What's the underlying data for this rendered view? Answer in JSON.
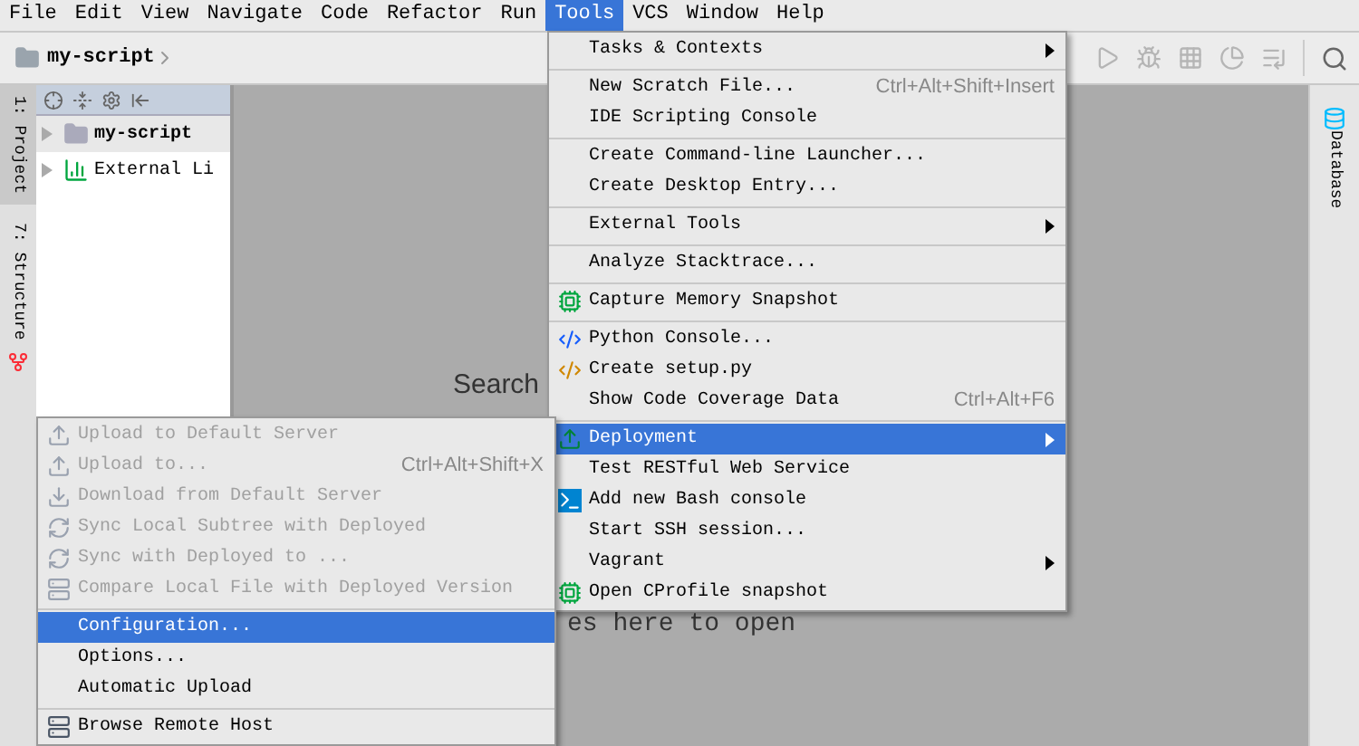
{
  "menubar": [
    {
      "label": "File",
      "selected": false
    },
    {
      "label": "Edit",
      "selected": false
    },
    {
      "label": "View",
      "selected": false
    },
    {
      "label": "Navigate",
      "selected": false
    },
    {
      "label": "Code",
      "selected": false
    },
    {
      "label": "Refactor",
      "selected": false
    },
    {
      "label": "Run",
      "selected": false
    },
    {
      "label": "Tools",
      "selected": true
    },
    {
      "label": "VCS",
      "selected": false
    },
    {
      "label": "Window",
      "selected": false
    },
    {
      "label": "Help",
      "selected": false
    }
  ],
  "navbar": {
    "breadcrumb": "my-script"
  },
  "left_strip": {
    "tabs": [
      "1: Project",
      "7: Structure"
    ]
  },
  "right_strip": {
    "tabs": [
      "Database"
    ]
  },
  "project_tree": [
    {
      "label": "my-script",
      "bold": true
    },
    {
      "label": "External Li",
      "bold": false
    }
  ],
  "editor": {
    "hint_1": "Search",
    "hint_2": "es here to open"
  },
  "tools_menu": {
    "groups": [
      [
        {
          "label": "Tasks & Contexts",
          "submenu": true,
          "selected": false
        }
      ],
      [
        {
          "label": "New Scratch File...",
          "shortcut": "Ctrl+Alt+Shift+Insert",
          "submenu": false,
          "selected": false
        },
        {
          "label": "IDE Scripting Console",
          "submenu": false,
          "selected": false
        }
      ],
      [
        {
          "label": "Create Command-line Launcher...",
          "submenu": false,
          "selected": false
        },
        {
          "label": "Create Desktop Entry...",
          "submenu": false,
          "selected": false
        }
      ],
      [
        {
          "label": "External Tools",
          "submenu": true,
          "selected": false
        }
      ],
      [
        {
          "label": "Analyze Stacktrace...",
          "submenu": false,
          "selected": false
        }
      ],
      [
        {
          "label": "Capture Memory Snapshot",
          "submenu": false,
          "selected": false
        }
      ],
      [
        {
          "label": "Python Console...",
          "submenu": false,
          "selected": false
        },
        {
          "label": "Create setup.py",
          "submenu": false,
          "selected": false
        },
        {
          "label": "Show Code Coverage Data",
          "shortcut": "Ctrl+Alt+F6",
          "submenu": false,
          "selected": false
        }
      ],
      [
        {
          "label": "Deployment",
          "submenu": true,
          "selected": true
        },
        {
          "label": "Test RESTful Web Service",
          "submenu": false,
          "selected": false
        },
        {
          "label": "Add new Bash console",
          "submenu": false,
          "selected": false
        },
        {
          "label": "Start SSH session...",
          "submenu": false,
          "selected": false
        },
        {
          "label": "Vagrant",
          "submenu": true,
          "selected": false
        },
        {
          "label": "Open CProfile snapshot",
          "submenu": false,
          "selected": false
        }
      ]
    ]
  },
  "deployment_menu": {
    "groups": [
      [
        {
          "label": "Upload to Default Server",
          "disabled": true,
          "selected": false
        },
        {
          "label": "Upload to...",
          "shortcut": "Ctrl+Alt+Shift+X",
          "disabled": true,
          "selected": false
        },
        {
          "label": "Download from Default Server",
          "disabled": true,
          "selected": false
        },
        {
          "label": "Sync Local Subtree with Deployed",
          "disabled": true,
          "selected": false
        },
        {
          "label": "Sync with Deployed to ...",
          "disabled": true,
          "selected": false
        },
        {
          "label": "Compare Local File with Deployed Version",
          "disabled": true,
          "selected": false
        }
      ],
      [
        {
          "label": "Configuration...",
          "disabled": false,
          "selected": true
        },
        {
          "label": "Options...",
          "disabled": false,
          "selected": false
        },
        {
          "label": "Automatic Upload",
          "disabled": false,
          "selected": false
        }
      ],
      [
        {
          "label": "Browse Remote Host",
          "disabled": false,
          "selected": false
        }
      ]
    ]
  }
}
